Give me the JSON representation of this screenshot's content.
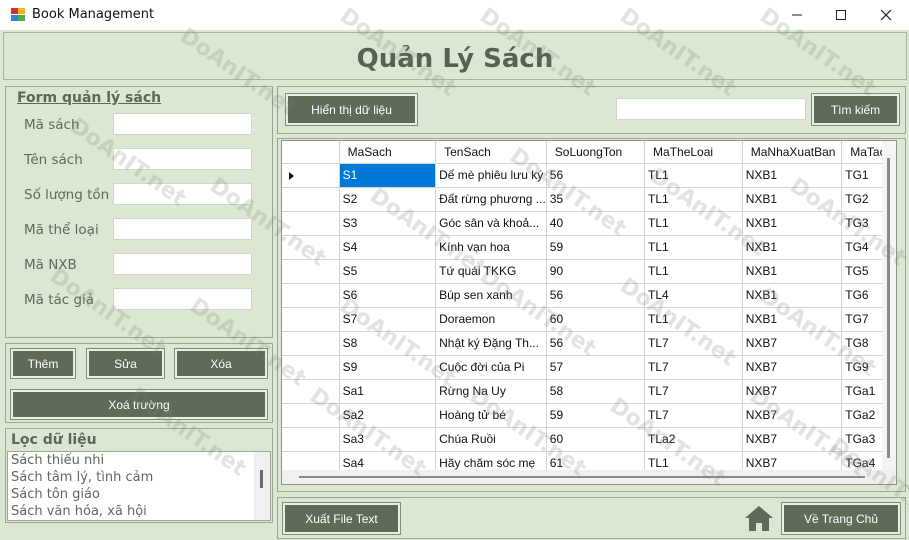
{
  "window": {
    "title": "Book Management",
    "controls": {
      "minimize": "minimize-icon",
      "maximize": "maximize-icon",
      "close": "close-icon"
    }
  },
  "header": {
    "title": "Quản Lý Sách"
  },
  "form": {
    "group_title": "Form quản lý sách",
    "fields": [
      {
        "label": "Mã sách",
        "value": ""
      },
      {
        "label": "Tên sách",
        "value": ""
      },
      {
        "label": "Số lượng tồn",
        "value": ""
      },
      {
        "label": "Mã thể loại",
        "value": ""
      },
      {
        "label": "Mã NXB",
        "value": ""
      },
      {
        "label": "Mã tác giả",
        "value": ""
      }
    ]
  },
  "actions": {
    "add": "Thêm",
    "edit": "Sửa",
    "delete": "Xóa",
    "clear": "Xoá trường"
  },
  "filter": {
    "title": "Lọc dữ liệu",
    "items": [
      "Sách thiếu nhi",
      "Sách tâm lý, tình cảm",
      "Sách tôn giáo",
      "Sách văn hóa, xã hội"
    ]
  },
  "toolbar": {
    "show_data": "Hiển thị dữ liệu",
    "search_value": "",
    "search_button": "Tìm kiếm"
  },
  "grid": {
    "columns": [
      "MaSach",
      "TenSach",
      "SoLuongTon",
      "MaTheLoai",
      "MaNhaXuatBan",
      "MaTacG"
    ],
    "rows": [
      [
        "S1",
        "Dế mè phiêu lưu ký",
        "56",
        "TL1",
        "NXB1",
        "TG1"
      ],
      [
        "S2",
        "Đất rừng phương ...",
        "35",
        "TL1",
        "NXB1",
        "TG2"
      ],
      [
        "S3",
        "Góc sân và khoả...",
        "40",
        "TL1",
        "NXB1",
        "TG3"
      ],
      [
        "S4",
        "Kính vạn hoa",
        "59",
        "TL1",
        "NXB1",
        "TG4"
      ],
      [
        "S5",
        "Tứ quái TKKG",
        "90",
        "TL1",
        "NXB1",
        "TG5"
      ],
      [
        "S6",
        "Búp sen xanh",
        "56",
        "TL4",
        "NXB1",
        "TG6"
      ],
      [
        "S7",
        "Doraemon",
        "60",
        "TL1",
        "NXB1",
        "TG7"
      ],
      [
        "S8",
        "Nhật ký Đặng Th...",
        "56",
        "TL7",
        "NXB7",
        "TG8"
      ],
      [
        "S9",
        "Cuộc đời của Pi",
        "57",
        "TL7",
        "NXB7",
        "TG9"
      ],
      [
        "Sa1",
        "Rừng Na Uy",
        "58",
        "TL7",
        "NXB7",
        "TGa1"
      ],
      [
        "Sa2",
        "Hoàng tử bé",
        "59",
        "TL7",
        "NXB7",
        "TGa2"
      ],
      [
        "Sa3",
        "Chúa Ruồi",
        "60",
        "TLa2",
        "NXB7",
        "TGa3"
      ],
      [
        "Sa4",
        "Hãy chăm sóc mẹ",
        "61",
        "TL1",
        "NXB7",
        "TGa4"
      ]
    ],
    "selected_row": 0
  },
  "footer": {
    "export": "Xuất File Text",
    "home": "Về Trang Chủ",
    "home_icon": "home-icon"
  },
  "watermark": "DoAnIT.net"
}
